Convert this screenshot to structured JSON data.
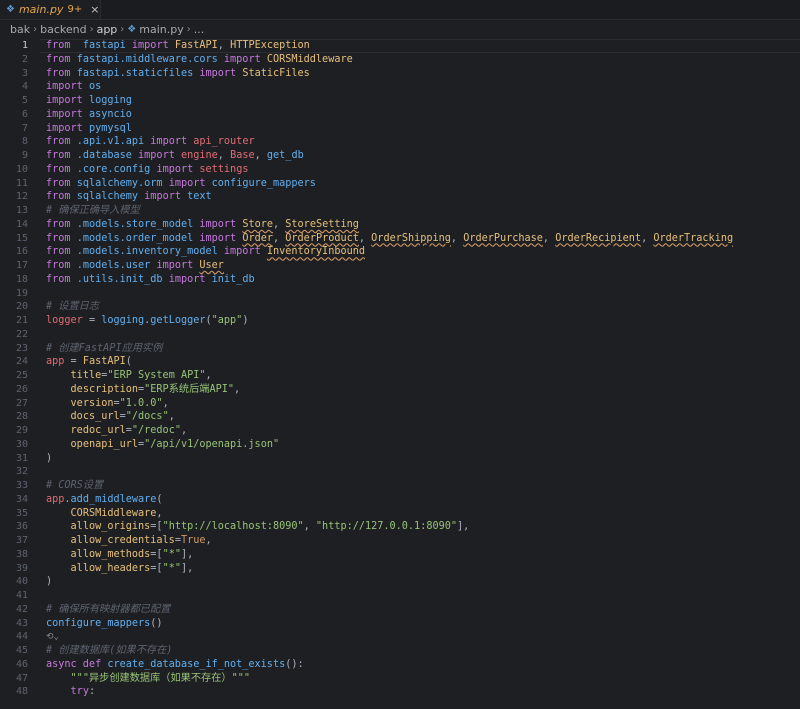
{
  "tab": {
    "filename": "main.py",
    "problems": "9+",
    "close": "×"
  },
  "breadcrumb": [
    "bak",
    "backend",
    "app",
    "main.py",
    "..."
  ],
  "lines": [
    {
      "n": "1",
      "t": [
        [
          "k",
          "from"
        ],
        [
          "",
          "  "
        ],
        [
          "fn",
          "fastapi"
        ],
        [
          "",
          " "
        ],
        [
          "k",
          "import"
        ],
        [
          "",
          " "
        ],
        [
          "cls",
          "FastAPI"
        ],
        [
          "",
          ", "
        ],
        [
          "cls",
          "HTTPException"
        ]
      ]
    },
    {
      "n": "2",
      "t": [
        [
          "k",
          "from"
        ],
        [
          "",
          " "
        ],
        [
          "fn",
          "fastapi.middleware.cors"
        ],
        [
          "",
          " "
        ],
        [
          "k",
          "import"
        ],
        [
          "",
          " "
        ],
        [
          "cls",
          "CORSMiddleware"
        ]
      ]
    },
    {
      "n": "3",
      "t": [
        [
          "k",
          "from"
        ],
        [
          "",
          " "
        ],
        [
          "fn",
          "fastapi.staticfiles"
        ],
        [
          "",
          " "
        ],
        [
          "k",
          "import"
        ],
        [
          "",
          " "
        ],
        [
          "cls",
          "StaticFiles"
        ]
      ]
    },
    {
      "n": "4",
      "t": [
        [
          "k",
          "import"
        ],
        [
          "",
          " "
        ],
        [
          "fn",
          "os"
        ]
      ]
    },
    {
      "n": "5",
      "t": [
        [
          "k",
          "import"
        ],
        [
          "",
          " "
        ],
        [
          "fn",
          "logging"
        ]
      ]
    },
    {
      "n": "6",
      "t": [
        [
          "k",
          "import"
        ],
        [
          "",
          " "
        ],
        [
          "fn",
          "asyncio"
        ]
      ]
    },
    {
      "n": "7",
      "t": [
        [
          "k",
          "import"
        ],
        [
          "",
          " "
        ],
        [
          "fn",
          "pymysql"
        ]
      ]
    },
    {
      "n": "8",
      "t": [
        [
          "k",
          "from"
        ],
        [
          "",
          " "
        ],
        [
          "fn",
          ".api.v1.api"
        ],
        [
          "",
          " "
        ],
        [
          "k",
          "import"
        ],
        [
          "",
          " "
        ],
        [
          "v",
          "api_router"
        ]
      ]
    },
    {
      "n": "9",
      "t": [
        [
          "k",
          "from"
        ],
        [
          "",
          " "
        ],
        [
          "fn",
          ".database"
        ],
        [
          "",
          " "
        ],
        [
          "k",
          "import"
        ],
        [
          "",
          " "
        ],
        [
          "v",
          "engine"
        ],
        [
          "",
          ", "
        ],
        [
          "v",
          "Base"
        ],
        [
          "",
          ", "
        ],
        [
          "fn",
          "get_db"
        ]
      ]
    },
    {
      "n": "10",
      "t": [
        [
          "k",
          "from"
        ],
        [
          "",
          " "
        ],
        [
          "fn",
          ".core.config"
        ],
        [
          "",
          " "
        ],
        [
          "k",
          "import"
        ],
        [
          "",
          " "
        ],
        [
          "v",
          "settings"
        ]
      ]
    },
    {
      "n": "11",
      "t": [
        [
          "k",
          "from"
        ],
        [
          "",
          " "
        ],
        [
          "fn",
          "sqlalchemy.orm"
        ],
        [
          "",
          " "
        ],
        [
          "k",
          "import"
        ],
        [
          "",
          " "
        ],
        [
          "fn",
          "configure_mappers"
        ]
      ]
    },
    {
      "n": "12",
      "t": [
        [
          "k",
          "from"
        ],
        [
          "",
          " "
        ],
        [
          "fn",
          "sqlalchemy"
        ],
        [
          "",
          " "
        ],
        [
          "k",
          "import"
        ],
        [
          "",
          " "
        ],
        [
          "fn",
          "text"
        ]
      ]
    },
    {
      "n": "13",
      "t": [
        [
          "c",
          "# 确保正确导入模型"
        ]
      ]
    },
    {
      "n": "14",
      "t": [
        [
          "k",
          "from"
        ],
        [
          "",
          " "
        ],
        [
          "fn",
          ".models.store_model"
        ],
        [
          "",
          " "
        ],
        [
          "k",
          "import"
        ],
        [
          "",
          " "
        ],
        [
          "cls u",
          "Store"
        ],
        [
          "",
          ", "
        ],
        [
          "cls u",
          "StoreSetting"
        ]
      ]
    },
    {
      "n": "15",
      "t": [
        [
          "k",
          "from"
        ],
        [
          "",
          " "
        ],
        [
          "fn",
          ".models.order_model"
        ],
        [
          "",
          " "
        ],
        [
          "k",
          "import"
        ],
        [
          "",
          " "
        ],
        [
          "cls u",
          "Order"
        ],
        [
          "",
          ", "
        ],
        [
          "cls u",
          "OrderProduct"
        ],
        [
          "",
          ", "
        ],
        [
          "cls u",
          "OrderShipping"
        ],
        [
          "",
          ", "
        ],
        [
          "cls u",
          "OrderPurchase"
        ],
        [
          "",
          ", "
        ],
        [
          "cls u",
          "OrderRecipient"
        ],
        [
          "",
          ", "
        ],
        [
          "cls u",
          "OrderTracking"
        ]
      ]
    },
    {
      "n": "16",
      "t": [
        [
          "k",
          "from"
        ],
        [
          "",
          " "
        ],
        [
          "fn",
          ".models.inventory_model"
        ],
        [
          "",
          " "
        ],
        [
          "k",
          "import"
        ],
        [
          "",
          " "
        ],
        [
          "cls u",
          "InventoryInbound"
        ]
      ]
    },
    {
      "n": "17",
      "t": [
        [
          "k",
          "from"
        ],
        [
          "",
          " "
        ],
        [
          "fn",
          ".models.user"
        ],
        [
          "",
          " "
        ],
        [
          "k",
          "import"
        ],
        [
          "",
          " "
        ],
        [
          "cls u",
          "User"
        ]
      ]
    },
    {
      "n": "18",
      "t": [
        [
          "k",
          "from"
        ],
        [
          "",
          " "
        ],
        [
          "fn",
          ".utils.init_db"
        ],
        [
          "",
          " "
        ],
        [
          "k",
          "import"
        ],
        [
          "",
          " "
        ],
        [
          "fn",
          "init_db"
        ]
      ]
    },
    {
      "n": "19",
      "t": []
    },
    {
      "n": "20",
      "t": [
        [
          "c",
          "# 设置日志"
        ]
      ]
    },
    {
      "n": "21",
      "t": [
        [
          "v",
          "logger"
        ],
        [
          "",
          " = "
        ],
        [
          "fn",
          "logging"
        ],
        [
          "",
          "."
        ],
        [
          "fn",
          "getLogger"
        ],
        [
          "",
          "("
        ],
        [
          "s",
          "\"app\""
        ],
        [
          "",
          ")"
        ]
      ]
    },
    {
      "n": "22",
      "t": []
    },
    {
      "n": "23",
      "t": [
        [
          "c",
          "# 创建FastAPI应用实例"
        ]
      ]
    },
    {
      "n": "24",
      "t": [
        [
          "v",
          "app"
        ],
        [
          "",
          " = "
        ],
        [
          "cls",
          "FastAPI"
        ],
        [
          "",
          "("
        ]
      ]
    },
    {
      "n": "25",
      "t": [
        [
          "",
          "    "
        ],
        [
          "p",
          "title"
        ],
        [
          "",
          "="
        ],
        [
          "s",
          "\"ERP System API\""
        ],
        [
          "",
          ","
        ]
      ]
    },
    {
      "n": "26",
      "t": [
        [
          "",
          "    "
        ],
        [
          "p",
          "description"
        ],
        [
          "",
          "="
        ],
        [
          "s",
          "\"ERP系统后端API\""
        ],
        [
          "",
          ","
        ]
      ]
    },
    {
      "n": "27",
      "t": [
        [
          "",
          "    "
        ],
        [
          "p",
          "version"
        ],
        [
          "",
          "="
        ],
        [
          "s",
          "\"1.0.0\""
        ],
        [
          "",
          ","
        ]
      ]
    },
    {
      "n": "28",
      "t": [
        [
          "",
          "    "
        ],
        [
          "p",
          "docs_url"
        ],
        [
          "",
          "="
        ],
        [
          "s",
          "\"/docs\""
        ],
        [
          "",
          ","
        ]
      ]
    },
    {
      "n": "29",
      "t": [
        [
          "",
          "    "
        ],
        [
          "p",
          "redoc_url"
        ],
        [
          "",
          "="
        ],
        [
          "s",
          "\"/redoc\""
        ],
        [
          "",
          ","
        ]
      ]
    },
    {
      "n": "30",
      "t": [
        [
          "",
          "    "
        ],
        [
          "p",
          "openapi_url"
        ],
        [
          "",
          "="
        ],
        [
          "s",
          "\"/api/v1/openapi.json\""
        ]
      ]
    },
    {
      "n": "31",
      "t": [
        [
          "",
          ")"
        ]
      ]
    },
    {
      "n": "32",
      "t": []
    },
    {
      "n": "33",
      "t": [
        [
          "c",
          "# CORS设置"
        ]
      ]
    },
    {
      "n": "34",
      "t": [
        [
          "v",
          "app"
        ],
        [
          "",
          "."
        ],
        [
          "fn",
          "add_middleware"
        ],
        [
          "",
          "("
        ]
      ]
    },
    {
      "n": "35",
      "t": [
        [
          "",
          "    "
        ],
        [
          "cls",
          "CORSMiddleware"
        ],
        [
          "",
          ","
        ]
      ]
    },
    {
      "n": "36",
      "t": [
        [
          "",
          "    "
        ],
        [
          "p",
          "allow_origins"
        ],
        [
          "",
          "=["
        ],
        [
          "s",
          "\"http://localhost:8090\""
        ],
        [
          "",
          ", "
        ],
        [
          "s",
          "\"http://127.0.0.1:8090\""
        ],
        [
          "",
          "],"
        ]
      ]
    },
    {
      "n": "37",
      "t": [
        [
          "",
          "    "
        ],
        [
          "p",
          "allow_credentials"
        ],
        [
          "",
          "="
        ],
        [
          "num",
          "True"
        ],
        [
          "",
          ","
        ]
      ]
    },
    {
      "n": "38",
      "t": [
        [
          "",
          "    "
        ],
        [
          "p",
          "allow_methods"
        ],
        [
          "",
          "=["
        ],
        [
          "s",
          "\"*\""
        ],
        [
          "",
          "],"
        ]
      ]
    },
    {
      "n": "39",
      "t": [
        [
          "",
          "    "
        ],
        [
          "p",
          "allow_headers"
        ],
        [
          "",
          "=["
        ],
        [
          "s",
          "\"*\""
        ],
        [
          "",
          "],"
        ]
      ]
    },
    {
      "n": "40",
      "t": [
        [
          "",
          ")"
        ]
      ]
    },
    {
      "n": "41",
      "t": []
    },
    {
      "n": "42",
      "t": [
        [
          "c",
          "# 确保所有映射器都已配置"
        ]
      ]
    },
    {
      "n": "43",
      "t": [
        [
          "fn",
          "configure_mappers"
        ],
        [
          "",
          "()"
        ]
      ]
    },
    {
      "n": "44",
      "t": [
        [
          "fold",
          "⟲⌄"
        ]
      ]
    },
    {
      "n": "45",
      "t": [
        [
          "c",
          "# 创建数据库(如果不存在)"
        ]
      ]
    },
    {
      "n": "46",
      "t": [
        [
          "k",
          "async def"
        ],
        [
          "",
          " "
        ],
        [
          "fn",
          "create_database_if_not_exists"
        ],
        [
          "",
          "():"
        ]
      ]
    },
    {
      "n": "47",
      "t": [
        [
          "",
          "    "
        ],
        [
          "s",
          "\"\"\"异步创建数据库（如果不存在）\"\"\""
        ]
      ]
    },
    {
      "n": "48",
      "t": [
        [
          "",
          "    "
        ],
        [
          "k",
          "try"
        ],
        [
          "",
          ":"
        ]
      ]
    }
  ]
}
